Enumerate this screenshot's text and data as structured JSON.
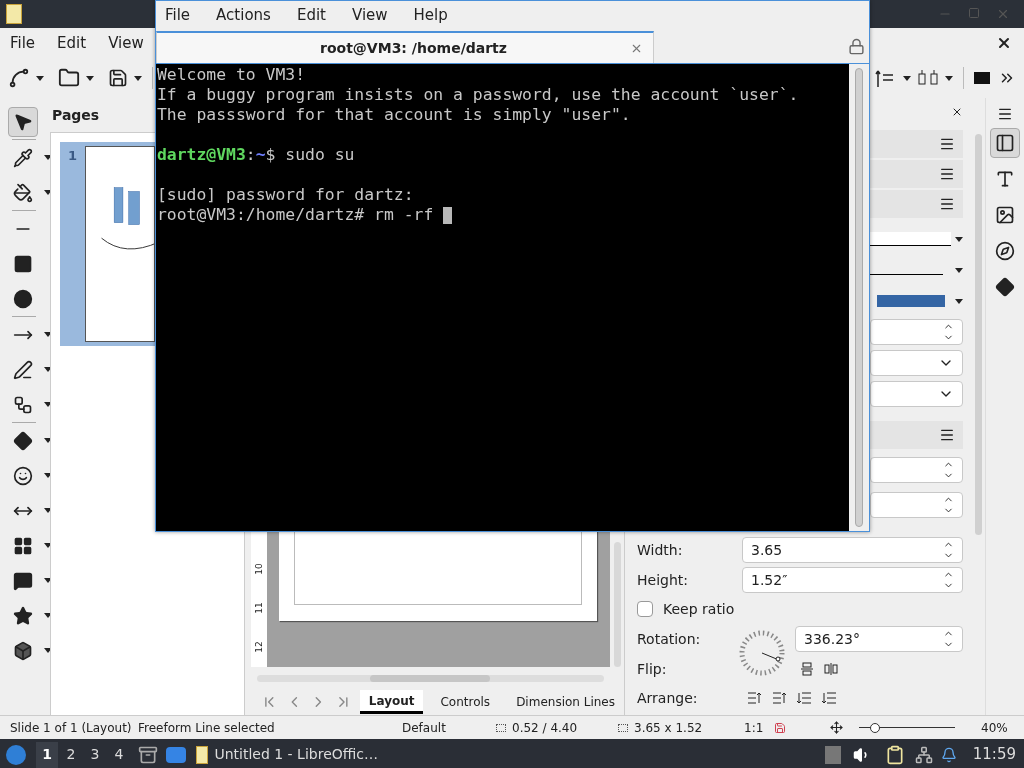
{
  "libreoffice": {
    "menu": [
      "File",
      "Edit",
      "View"
    ],
    "tools": [
      {
        "kind": "select",
        "selected": true
      },
      {
        "kind": "line-color",
        "selected": false
      },
      {
        "kind": "fill-color",
        "selected": false
      },
      {
        "kind": "line",
        "selected": false
      },
      {
        "kind": "rectangle",
        "selected": false
      },
      {
        "kind": "ellipse",
        "selected": false
      },
      {
        "kind": "arrow",
        "selected": false
      },
      {
        "kind": "freeform",
        "selected": false
      },
      {
        "kind": "connector",
        "selected": false
      },
      {
        "kind": "diamond",
        "selected": false
      },
      {
        "kind": "smiley",
        "selected": false
      },
      {
        "kind": "double-arrow",
        "selected": false
      },
      {
        "kind": "table",
        "selected": false
      },
      {
        "kind": "callout",
        "selected": false
      },
      {
        "kind": "star",
        "selected": false
      },
      {
        "kind": "cube",
        "selected": false
      }
    ],
    "pages_title": "Pages",
    "page_thumbnails": [
      {
        "number": "1",
        "selected": true
      }
    ],
    "ruler_marks": [
      "10",
      "11",
      "12"
    ],
    "tabs": [
      {
        "label": "Layout",
        "selected": true
      },
      {
        "label": "Controls",
        "selected": false
      },
      {
        "label": "Dimension Lines",
        "selected": false
      }
    ],
    "sidebar": {
      "width": {
        "label": "Width:",
        "value": "3.65"
      },
      "height": {
        "label": "Height:",
        "value": "1.52″"
      },
      "keep_ratio": {
        "label": "Keep ratio",
        "checked": false
      },
      "rotation": {
        "label": "Rotation:",
        "value": "336.23°"
      },
      "flip": {
        "label": "Flip:"
      },
      "arrange": {
        "label": "Arrange:"
      }
    },
    "deck_tabs": [
      {
        "kind": "properties",
        "selected": true
      },
      {
        "kind": "styles",
        "selected": false
      },
      {
        "kind": "gallery",
        "selected": false
      },
      {
        "kind": "navigator",
        "selected": false
      },
      {
        "kind": "shapes",
        "selected": false
      }
    ],
    "status_bar": {
      "slide": "Slide 1 of 1 (Layout)",
      "selection": "Freeform Line selected",
      "master": "Default",
      "position": "0.52 / 4.40",
      "size": "3.65 x 1.52",
      "scale": "1:1",
      "zoom_slider": {
        "level": 0.17
      },
      "zoom": "40%"
    }
  },
  "terminal": {
    "menu": [
      "File",
      "Actions",
      "Edit",
      "View",
      "Help"
    ],
    "tab_title": "root@VM3: /home/dartz",
    "lines": [
      {
        "kind": "text",
        "text": "Welcome to VM3!"
      },
      {
        "kind": "text",
        "text": "If a buggy program insists on a password, use the account `user`."
      },
      {
        "kind": "text",
        "text": "The passsword for that account is simply \"user\"."
      },
      {
        "kind": "blank"
      },
      {
        "kind": "prompt",
        "user": "dartz@VM3",
        "sep": ":",
        "path": "~",
        "rest": "$ sudo su"
      },
      {
        "kind": "blank"
      },
      {
        "kind": "text",
        "text": "[sudo] password for dartz:"
      },
      {
        "kind": "text",
        "text": "root@VM3:/home/dartz# rm -rf ",
        "cursor": true
      }
    ]
  },
  "taskbar": {
    "workspaces": [
      {
        "label": "1",
        "selected": true
      },
      {
        "label": "2",
        "selected": false
      },
      {
        "label": "3",
        "selected": false
      },
      {
        "label": "4",
        "selected": false
      }
    ],
    "window_button": "Untitled 1 - LibreOffic…",
    "clock": "11:59"
  }
}
